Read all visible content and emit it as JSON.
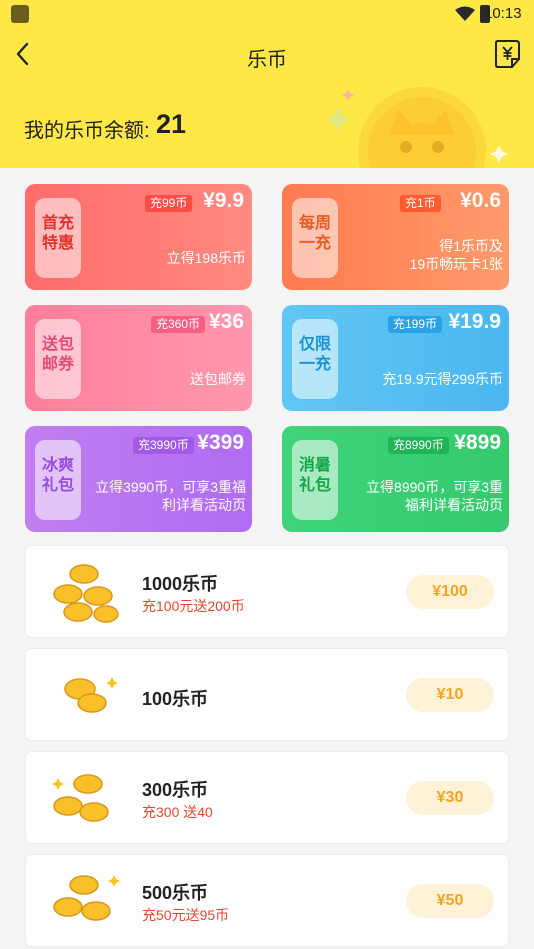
{
  "status": {
    "time": "10:13"
  },
  "header": {
    "title": "乐币",
    "back_icon": "back-arrow-icon",
    "bill_icon": "yuan-bill-icon"
  },
  "balance": {
    "label": "我的乐币余额:",
    "value": "21"
  },
  "colors": {
    "header_bg": "#fde845",
    "price_text": "#f0a420",
    "price_bg": "#fdf1d8",
    "promo_text": "#e8472f"
  },
  "promos": [
    {
      "tab": "首充特惠",
      "tag": "充99币",
      "price": "¥9.9",
      "desc": "立得198乐币"
    },
    {
      "tab": "每周一充",
      "tag": "充1币",
      "price": "¥0.6",
      "desc": "得1乐币及\n19币畅玩卡1张"
    },
    {
      "tab": "送包邮券",
      "tag": "充360币",
      "price": "¥36",
      "desc": "送包邮券"
    },
    {
      "tab": "仅限一充",
      "tag": "充199币",
      "price": "¥19.9",
      "desc": "充19.9元得299乐币"
    },
    {
      "tab": "冰爽礼包",
      "tag": "充3990币",
      "price": "¥399",
      "desc": "立得3990币，可享3重福\n利详看活动页"
    },
    {
      "tab": "消暑礼包",
      "tag": "充8990币",
      "price": "¥899",
      "desc": "立得8990币，可享3重\n福利详看活动页"
    }
  ],
  "packages": [
    {
      "name": "1000乐币",
      "sub": "充100元送200币",
      "price": "¥100"
    },
    {
      "name": "100乐币",
      "sub": "",
      "price": "¥10"
    },
    {
      "name": "300乐币",
      "sub": "充300 送40",
      "price": "¥30"
    },
    {
      "name": "500乐币",
      "sub": "充50元送95币",
      "price": "¥50"
    }
  ]
}
